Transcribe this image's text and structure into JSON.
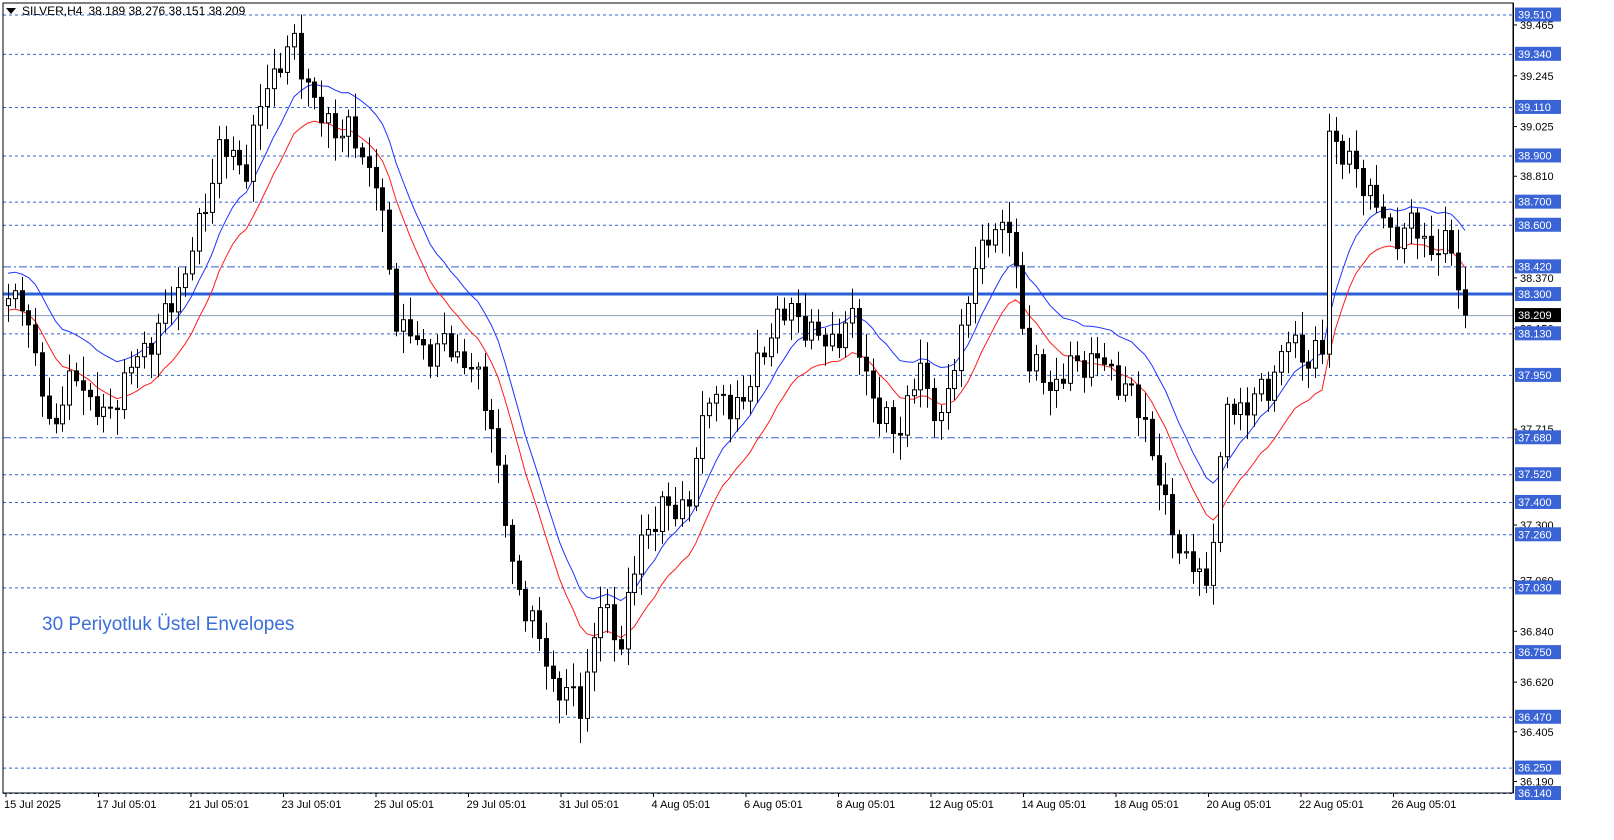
{
  "header": {
    "symbol": "SILVER,H4",
    "ohlc": "38.189 38.276 38.151 38.209"
  },
  "annotation": "30 Periyotluk Üstel Envelopes",
  "colors": {
    "background": "#ffffff",
    "candle": "#000000",
    "envelope_upper": "#1a33ff",
    "envelope_lower": "#ff1a1a",
    "level_line": "#3060d0",
    "key_level": "#2a5fd8",
    "tag_fill": "#3a64d6"
  },
  "chart_data": {
    "type": "candlestick",
    "symbol": "SILVER",
    "timeframe": "H4",
    "ylim": [
      36.14,
      39.56
    ],
    "current_price": "38.209",
    "x_tick_labels": [
      "15 Jul 2025",
      "17 Jul 05:01",
      "21 Jul 05:01",
      "23 Jul 05:01",
      "25 Jul 05:01",
      "29 Jul 05:01",
      "31 Jul 05:01",
      "4 Aug 05:01",
      "6 Aug 05:01",
      "8 Aug 05:01",
      "12 Aug 05:01",
      "14 Aug 05:01",
      "18 Aug 05:01",
      "20 Aug 05:01",
      "22 Aug 05:01",
      "26 Aug 05:01"
    ],
    "y_tick_labels": [
      "39.465",
      "39.245",
      "39.025",
      "38.810",
      "38.370",
      "38.150",
      "37.715",
      "37.300",
      "37.060",
      "36.840",
      "36.620",
      "36.405",
      "36.190"
    ],
    "horizontal_levels": [
      "39.510",
      "39.340",
      "39.110",
      "38.900",
      "38.700",
      "38.600",
      "38.420",
      "38.300",
      "38.130",
      "37.950",
      "37.680",
      "37.520",
      "37.400",
      "37.260",
      "37.030",
      "36.750",
      "36.470",
      "36.250",
      "36.140"
    ],
    "dashdot_levels": [
      "38.420",
      "37.680"
    ],
    "key_level": "38.300",
    "anchors": [
      [
        0,
        38.25
      ],
      [
        2,
        38.3
      ],
      [
        6,
        37.73
      ],
      [
        10,
        37.95
      ],
      [
        14,
        37.75
      ],
      [
        18,
        37.98
      ],
      [
        22,
        38.15
      ],
      [
        25,
        38.32
      ],
      [
        28,
        38.58
      ],
      [
        31,
        38.93
      ],
      [
        35,
        38.85
      ],
      [
        38,
        39.22
      ],
      [
        42,
        39.38
      ],
      [
        46,
        39.05
      ],
      [
        50,
        39.0
      ],
      [
        54,
        38.8
      ],
      [
        57,
        38.2
      ],
      [
        61,
        38.05
      ],
      [
        64,
        38.08
      ],
      [
        68,
        37.99
      ],
      [
        71,
        37.75
      ],
      [
        74,
        37.1
      ],
      [
        77,
        36.88
      ],
      [
        80,
        36.62
      ],
      [
        84,
        36.52
      ],
      [
        87,
        36.95
      ],
      [
        90,
        36.8
      ],
      [
        93,
        37.25
      ],
      [
        96,
        37.36
      ],
      [
        100,
        37.4
      ],
      [
        103,
        37.9
      ],
      [
        106,
        37.78
      ],
      [
        110,
        37.97
      ],
      [
        113,
        38.22
      ],
      [
        116,
        38.2
      ],
      [
        120,
        38.08
      ],
      [
        124,
        38.18
      ],
      [
        128,
        37.75
      ],
      [
        131,
        37.73
      ],
      [
        134,
        37.98
      ],
      [
        137,
        37.73
      ],
      [
        141,
        38.29
      ],
      [
        144,
        38.58
      ],
      [
        147,
        38.58
      ],
      [
        150,
        38.0
      ],
      [
        153,
        37.9
      ],
      [
        157,
        38.0
      ],
      [
        160,
        38.02
      ],
      [
        164,
        37.9
      ],
      [
        167,
        37.75
      ],
      [
        170,
        37.36
      ],
      [
        173,
        37.15
      ],
      [
        176,
        37.04
      ],
      [
        179,
        37.8
      ],
      [
        182,
        37.82
      ],
      [
        185,
        37.9
      ],
      [
        188,
        38.1
      ],
      [
        191,
        38.02
      ],
      [
        193,
        38.05
      ],
      [
        194,
        39.01
      ],
      [
        197,
        38.86
      ],
      [
        200,
        38.75
      ],
      [
        203,
        38.55
      ],
      [
        206,
        38.6
      ],
      [
        209,
        38.5
      ],
      [
        212,
        38.5
      ],
      [
        214,
        38.21
      ]
    ],
    "envelope_period": 30
  }
}
